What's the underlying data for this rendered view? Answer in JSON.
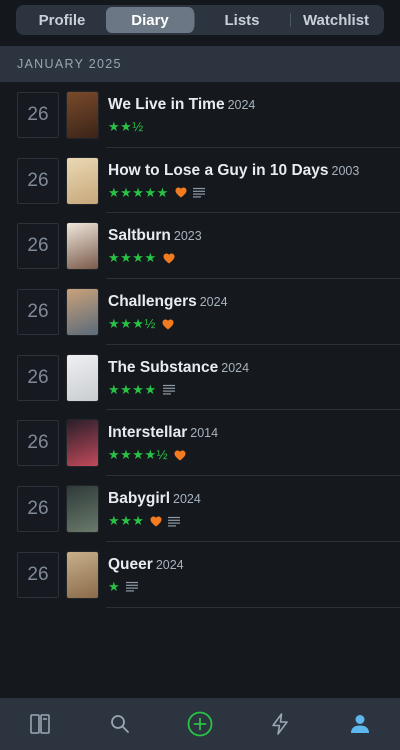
{
  "tabs": [
    {
      "label": "Profile",
      "active": false
    },
    {
      "label": "Diary",
      "active": true
    },
    {
      "label": "Lists",
      "active": false
    },
    {
      "label": "Watchlist",
      "active": false
    }
  ],
  "month_header": "JANUARY 2025",
  "entries": [
    {
      "day": "26",
      "title": "We Live in Time",
      "year": "2024",
      "stars": "★★½",
      "rating": 2.5,
      "liked": false,
      "reviewed": false,
      "poster_colors": [
        "#7a4a2a",
        "#3a2418"
      ]
    },
    {
      "day": "26",
      "title": "How to Lose a Guy in 10 Days",
      "year": "2003",
      "stars": "★★★★★",
      "rating": 5,
      "liked": true,
      "reviewed": true,
      "poster_colors": [
        "#e9d9b4",
        "#c7a77a"
      ]
    },
    {
      "day": "26",
      "title": "Saltburn",
      "year": "2023",
      "stars": "★★★★",
      "rating": 4,
      "liked": true,
      "reviewed": false,
      "poster_colors": [
        "#efe8dc",
        "#7a5a4a"
      ]
    },
    {
      "day": "26",
      "title": "Challengers",
      "year": "2024",
      "stars": "★★★½",
      "rating": 3.5,
      "liked": true,
      "reviewed": false,
      "poster_colors": [
        "#c9a27a",
        "#5a6a7a"
      ]
    },
    {
      "day": "26",
      "title": "The Substance",
      "year": "2024",
      "stars": "★★★★",
      "rating": 4,
      "liked": false,
      "reviewed": true,
      "poster_colors": [
        "#eef0f2",
        "#c9ccd0"
      ]
    },
    {
      "day": "26",
      "title": "Interstellar",
      "year": "2014",
      "stars": "★★★★½",
      "rating": 4.5,
      "liked": true,
      "reviewed": false,
      "poster_colors": [
        "#2a1e2a",
        "#c24a5a"
      ]
    },
    {
      "day": "26",
      "title": "Babygirl",
      "year": "2024",
      "stars": "★★★",
      "rating": 3,
      "liked": true,
      "reviewed": true,
      "poster_colors": [
        "#2e3a3a",
        "#6a7a6a"
      ]
    },
    {
      "day": "26",
      "title": "Queer",
      "year": "2024",
      "stars": "★",
      "rating": 1,
      "liked": false,
      "reviewed": true,
      "poster_colors": [
        "#c8b08a",
        "#8a6a4a"
      ]
    }
  ],
  "colors": {
    "star": "#28c244",
    "heart": "#f27b20",
    "review_icon": "#8f9aa6",
    "nav_icon": "#9aa6b2",
    "add_accent": "#28c244",
    "profile_accent": "#5fb7f0"
  },
  "nav": [
    {
      "icon": "diary-icon"
    },
    {
      "icon": "search-icon"
    },
    {
      "icon": "add-icon"
    },
    {
      "icon": "activity-icon"
    },
    {
      "icon": "profile-icon"
    }
  ]
}
